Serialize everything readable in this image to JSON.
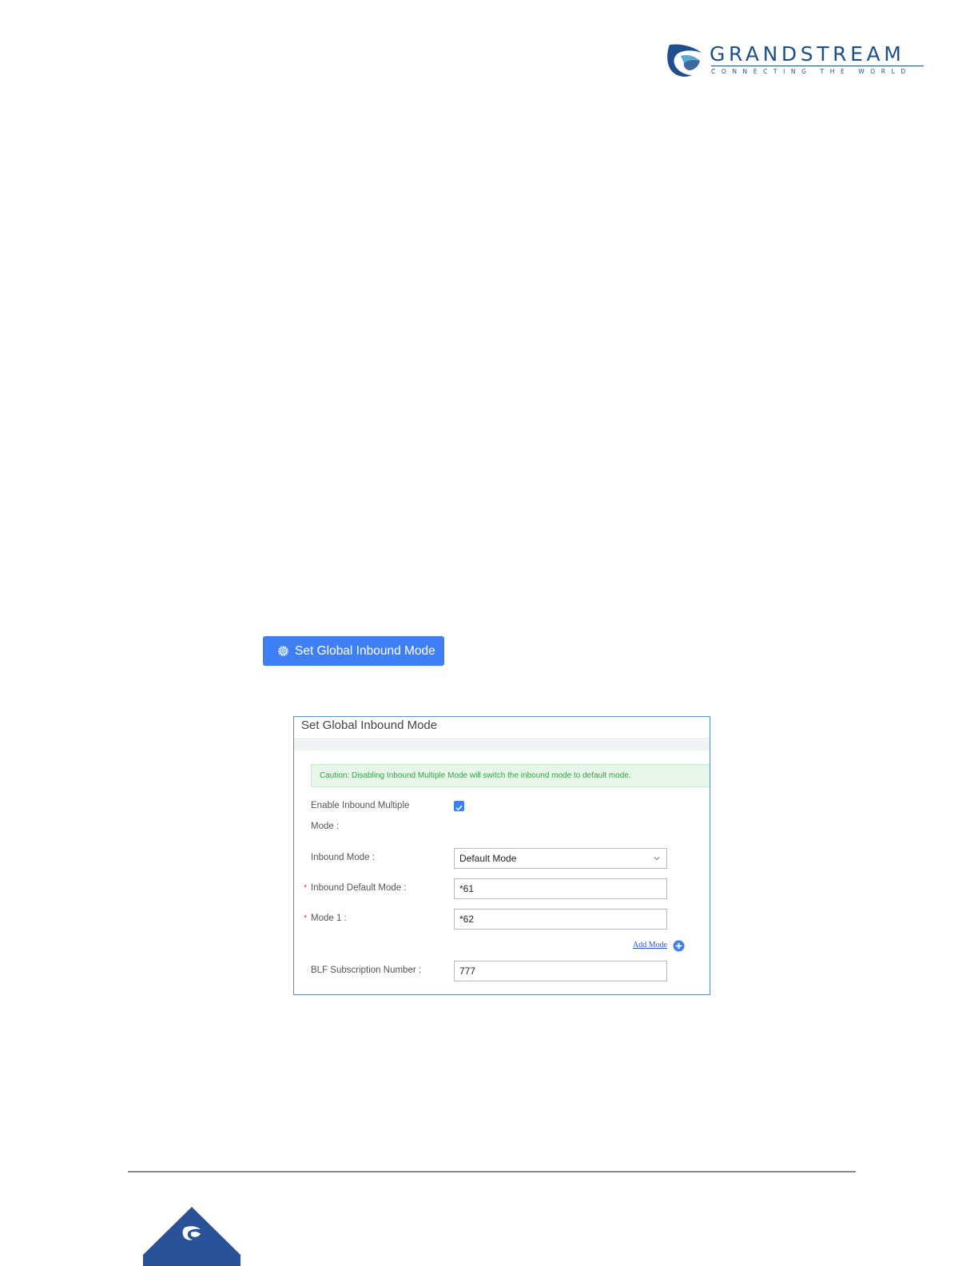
{
  "header": {
    "brand_name": "GRANDSTREAM",
    "brand_tagline": "CONNECTING THE WORLD",
    "logo_icon": "grandstream-logo-icon"
  },
  "toolbar": {
    "global_button_label": "Set Global Inbound Mode",
    "global_button_icon": "gear-icon"
  },
  "dialog": {
    "title": "Set Global Inbound Mode",
    "caution": "Caution: Disabling Inbound Multiple Mode will switch the inbound mode to default mode.",
    "fields": {
      "enable_multiple_label_line1": "Enable Inbound Multiple",
      "enable_multiple_label_line2": "Mode :",
      "enable_multiple_checked": true,
      "inbound_mode_label": "Inbound Mode :",
      "inbound_mode_value": "Default Mode",
      "inbound_default_mode_label": "Inbound Default Mode :",
      "inbound_default_mode_value": "*61",
      "mode1_label": "Mode 1 :",
      "mode1_value": "*62",
      "add_mode_label": "Add Mode",
      "blf_label": "BLF Subscription Number :",
      "blf_value": "777"
    },
    "required_mark": "*"
  },
  "colors": {
    "brand_blue": "#1d4f8c",
    "primary": "#3f7ff6",
    "caution_text": "#3a9e4a",
    "caution_bg": "#e6f7e9",
    "required": "#e0464a"
  }
}
